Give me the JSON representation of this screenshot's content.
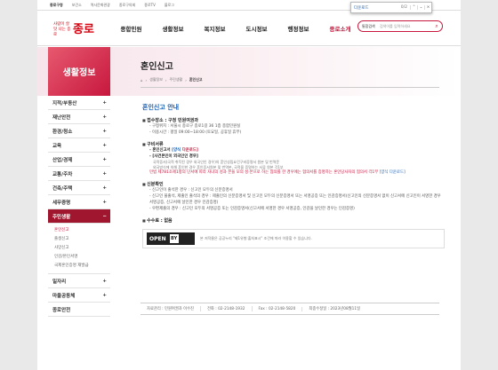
{
  "topbar": {
    "items": [
      "종로구청",
      "보건소",
      "역사문화관광",
      "종로구의회",
      "종로TV",
      "블로그"
    ]
  },
  "findbar": {
    "query": "다운로드",
    "count": "0/2",
    "up": "⌃",
    "down": "⌄",
    "close": "×"
  },
  "logo": {
    "slogan": "사람이 살맛 나는 종로",
    "name": "종로"
  },
  "gnb": [
    "종합민원",
    "생활정보",
    "복지정보",
    "도시정보",
    "행정정보",
    "종로소개"
  ],
  "search": {
    "select": "통합검색",
    "placeholder": "검색어를 입력하세요"
  },
  "lnb": {
    "title": "생활정보",
    "items": [
      {
        "label": "지적/부동산",
        "toggle": "+"
      },
      {
        "label": "재난안전",
        "toggle": "+"
      },
      {
        "label": "환경/청소",
        "toggle": "+"
      },
      {
        "label": "교육",
        "toggle": "+"
      },
      {
        "label": "산업/경제",
        "toggle": "+"
      },
      {
        "label": "교통/주차",
        "toggle": "+"
      },
      {
        "label": "건축/주택",
        "toggle": "+"
      },
      {
        "label": "세무증명",
        "toggle": "+"
      },
      {
        "label": "주민생활",
        "toggle": "−"
      }
    ],
    "sub": [
      "혼인신고",
      "출생신고",
      "사망신고",
      "인감/본인서명",
      "국제혼인증명 재발급"
    ],
    "items2": [
      {
        "label": "일자리",
        "toggle": "+"
      },
      {
        "label": "마을공동체",
        "toggle": "+"
      },
      {
        "label": "종로안전",
        "toggle": ""
      }
    ]
  },
  "content": {
    "title": "혼인신고",
    "breadcrumb": [
      "⌂",
      "생활정보",
      "주민생활",
      "혼인신고"
    ],
    "subtitle": "혼인신고 안내",
    "s1": "접수장소 : 구청 민원여권과",
    "s1_items": [
      "구청위치 : 서울시 종로구 종로1길 36 1층 종합민원실",
      "이용시간 : 평일 09:00~18:00 (토요일, 공휴일 휴무)"
    ],
    "s2": "구비서류",
    "s2_item1": "혼인신고서",
    "s2_item1_link": "[양식",
    "s2_item1_dl": "다운로드]",
    "s2_item2": "[사건본인이 외국인인 경우]",
    "s2_notes": [
      "국적증서(국적 취득된 경우 외국인인 경우)의 혼인성립요건구비증명서 원본 및 번역문",
      "외국방식에 의해 혼인한 경우 혼인증서원본 및 번역본, 국적을 증명하는 서류 원본 각1부"
    ],
    "s2_item3": "민법 제781조제1항의 단서에 따라 자녀의 성과 본을 모의 성·본으로 하는 협의를 한 경우에는 협의서를 증명하는 혼인당사자의 협의서 각1부",
    "s2_item3_link": "[양식 다운로드]",
    "s3": "신분확인",
    "s3_items": [
      "신고인이 출석한 경우 : 신고인 모두의 신분증명서",
      "신고인 불출석, 제출인 출석의 경우 : 제출인의 신분증명서 및 신고인 모두의 신분증명서 또는 서명공증 또는 인감증명서(신고인의 신분증명서 없이 신고서에 신고인이 서명한 경우 서명공증, 신고서에 날인한 경우 인감증명)",
      "우편제출의 경우 : 신고인 모두의 서명공증 또는 인감증명서(신고서에 서명한 경우 서명공증, 인감을 날인한 경우는 인감증명)"
    ],
    "s4": "수수료 : 없음",
    "open_label": "OPEN",
    "open_badge": "BY",
    "open_text": "본 저작물은 공공누리 \"제1유형:출처표시\" 조건에 따라 이용할 수 있습니다."
  },
  "footer": [
    "자료관리 : 민원여권과 이수진",
    "전화 : 02-2148-1932",
    "Fax : 02-2148-5820",
    "최종수정일 : 2023년08월11일"
  ]
}
